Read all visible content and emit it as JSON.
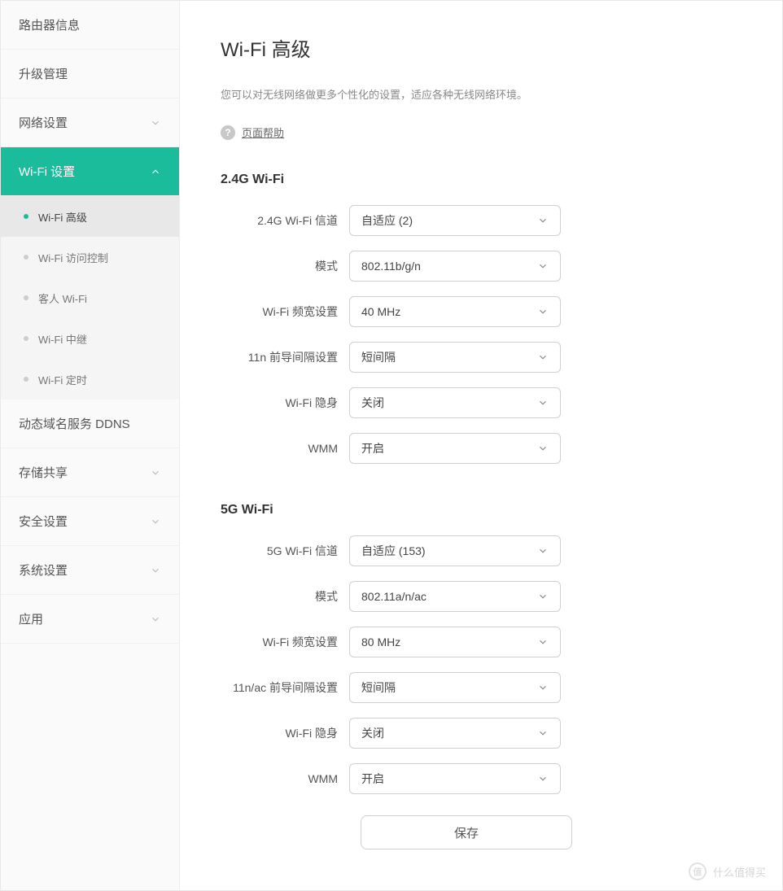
{
  "sidebar": {
    "items": [
      {
        "label": "路由器信息",
        "expandable": false
      },
      {
        "label": "升级管理",
        "expandable": false
      },
      {
        "label": "网络设置",
        "expandable": true,
        "expanded": false
      },
      {
        "label": "Wi-Fi 设置",
        "expandable": true,
        "expanded": true,
        "active": true,
        "children": [
          {
            "label": "Wi-Fi 高级",
            "selected": true
          },
          {
            "label": "Wi-Fi 访问控制",
            "selected": false
          },
          {
            "label": "客人 Wi-Fi",
            "selected": false
          },
          {
            "label": "Wi-Fi 中继",
            "selected": false
          },
          {
            "label": "Wi-Fi 定时",
            "selected": false
          }
        ]
      },
      {
        "label": "动态域名服务 DDNS",
        "expandable": false
      },
      {
        "label": "存储共享",
        "expandable": true,
        "expanded": false
      },
      {
        "label": "安全设置",
        "expandable": true,
        "expanded": false
      },
      {
        "label": "系统设置",
        "expandable": true,
        "expanded": false
      },
      {
        "label": "应用",
        "expandable": true,
        "expanded": false
      }
    ]
  },
  "page": {
    "title": "Wi-Fi 高级",
    "description": "您可以对无线网络做更多个性化的设置，适应各种无线网络环境。",
    "help_label": "页面帮助"
  },
  "sections": {
    "g24": {
      "title": "2.4G Wi-Fi",
      "fields": [
        {
          "label": "2.4G Wi-Fi 信道",
          "value": "自适应 (2)"
        },
        {
          "label": "模式",
          "value": "802.11b/g/n"
        },
        {
          "label": "Wi-Fi 频宽设置",
          "value": "40 MHz"
        },
        {
          "label": "11n 前导间隔设置",
          "value": "短间隔"
        },
        {
          "label": "Wi-Fi 隐身",
          "value": "关闭"
        },
        {
          "label": "WMM",
          "value": "开启"
        }
      ]
    },
    "g5": {
      "title": "5G Wi-Fi",
      "fields": [
        {
          "label": "5G Wi-Fi 信道",
          "value": "自适应 (153)"
        },
        {
          "label": "模式",
          "value": "802.11a/n/ac"
        },
        {
          "label": "Wi-Fi 频宽设置",
          "value": "80 MHz"
        },
        {
          "label": "11n/ac 前导间隔设置",
          "value": "短间隔"
        },
        {
          "label": "Wi-Fi 隐身",
          "value": "关闭"
        },
        {
          "label": "WMM",
          "value": "开启"
        }
      ]
    }
  },
  "buttons": {
    "save": "保存"
  },
  "watermark": {
    "symbol": "值",
    "text": "什么值得买"
  }
}
